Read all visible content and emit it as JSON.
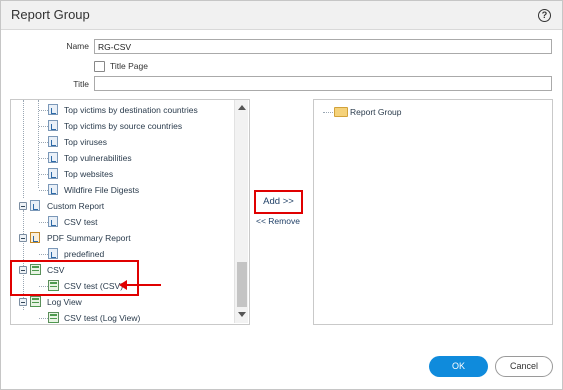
{
  "dialog": {
    "title": "Report Group",
    "help_icon": "help-circle-icon",
    "help_glyph": "?"
  },
  "form": {
    "name_label": "Name",
    "name_value": "RG-CSV",
    "title_page_label": "Title Page",
    "title_page_checked": false,
    "title_label": "Title",
    "title_value": ""
  },
  "left_tree": {
    "items": [
      {
        "label": "Top victims by destination countries",
        "icon": "report-icon"
      },
      {
        "label": "Top victims by source countries",
        "icon": "report-icon"
      },
      {
        "label": "Top viruses",
        "icon": "report-icon"
      },
      {
        "label": "Top vulnerabilities",
        "icon": "report-icon"
      },
      {
        "label": "Top websites",
        "icon": "report-icon"
      },
      {
        "label": "Wildfire File Digests",
        "icon": "report-icon"
      },
      {
        "label": "Custom Report",
        "icon": "custom-report-folder-icon"
      },
      {
        "label": "CSV test",
        "icon": "report-icon"
      },
      {
        "label": "PDF Summary Report",
        "icon": "pdf-summary-folder-icon"
      },
      {
        "label": "predefined",
        "icon": "pdf-report-icon"
      },
      {
        "label": "CSV",
        "icon": "csv-folder-icon"
      },
      {
        "label": "CSV test (CSV)",
        "icon": "csv-report-icon"
      },
      {
        "label": "Log View",
        "icon": "log-view-folder-icon"
      },
      {
        "label": "CSV test (Log View)",
        "icon": "csv-report-icon"
      }
    ]
  },
  "actions": {
    "add_label": "Add >>",
    "remove_label": "<< Remove"
  },
  "right_tree": {
    "root_label": "Report Group",
    "root_icon": "folder-icon"
  },
  "footer": {
    "ok_label": "OK",
    "cancel_label": "Cancel"
  },
  "colors": {
    "primary_button": "#0f8bdc",
    "highlight": "#e00000"
  }
}
